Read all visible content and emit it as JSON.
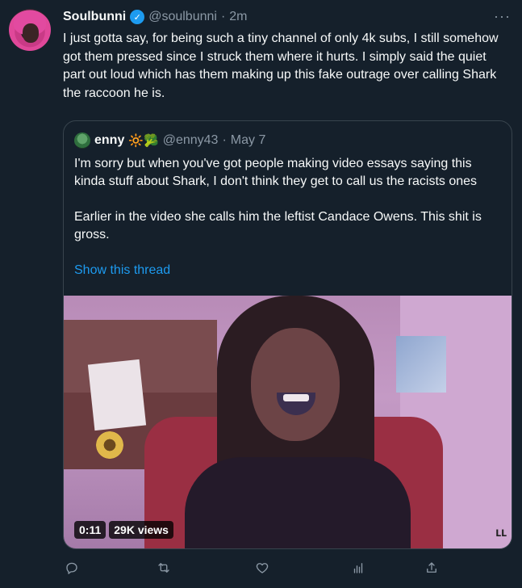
{
  "tweet": {
    "author": {
      "name": "Soulbunni",
      "handle": "@soulbunni",
      "separator": "·",
      "time": "2m"
    },
    "text": "I just gotta say, for being such a tiny channel of only 4k subs, I still somehow got them pressed since I struck them where it hurts. I simply said the quiet part out loud which has them making up this fake outrage over calling Shark the raccoon he is.",
    "more_label": "···",
    "verified_glyph": "✓"
  },
  "quote": {
    "author": {
      "name": "enny",
      "emojis": "🔆🥦",
      "handle": "@enny43",
      "separator": "·",
      "time": "May 7"
    },
    "paragraphs": [
      "I'm sorry but when you've got people making video essays saying this kinda stuff about Shark, I don't think they get to call us the racists ones",
      "Earlier in the video she calls him the leftist Candace Owens. This shit is gross."
    ],
    "show_thread": "Show this thread",
    "video": {
      "duration": "0:11",
      "views": "29K views",
      "watermark": "ᒪᒪ"
    }
  },
  "actions": {
    "icons": [
      "reply-icon",
      "retweet-icon",
      "like-icon",
      "views-icon",
      "share-icon"
    ]
  },
  "colors": {
    "background": "#15202b",
    "text": "#f7f9f9",
    "muted": "#8b98a5",
    "accent": "#1d9bf0",
    "border": "#38444d"
  }
}
